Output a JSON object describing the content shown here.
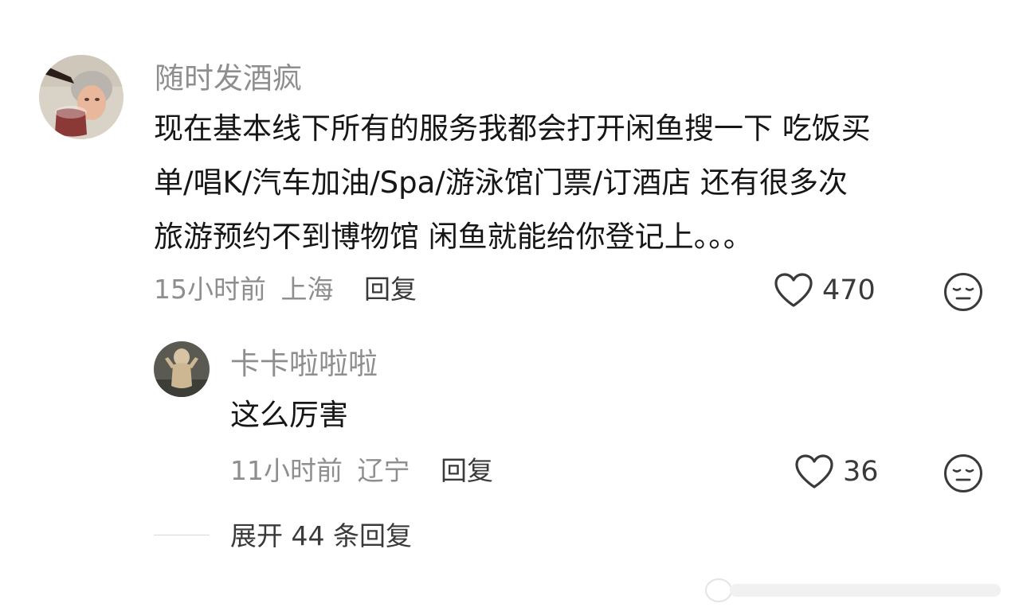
{
  "comment": {
    "username": "随时发酒疯",
    "text_lines": [
      "现在基本线下所有的服务我都会打开闲鱼搜一下 吃饭买",
      "单/唱K/汽车加油/Spa/游泳馆门票/订酒店 还有很多次",
      "旅游预约不到博物馆 闲鱼就能给你登记上。。。"
    ],
    "time": "15小时前",
    "location": "上海",
    "reply_label": "回复",
    "likes": "470"
  },
  "reply": {
    "username": "卡卡啦啦啦",
    "text": "这么厉害",
    "time": "11小时前",
    "location": "辽宁",
    "reply_label": "回复",
    "likes": "36"
  },
  "expand_label": "展开 44 条回复",
  "icons": {
    "like": "heart-outline-icon",
    "dislike": "neutral-face-icon"
  },
  "colors": {
    "text_primary": "#161616",
    "text_secondary": "#8e8e8e",
    "icon": "#3a3a3a"
  }
}
